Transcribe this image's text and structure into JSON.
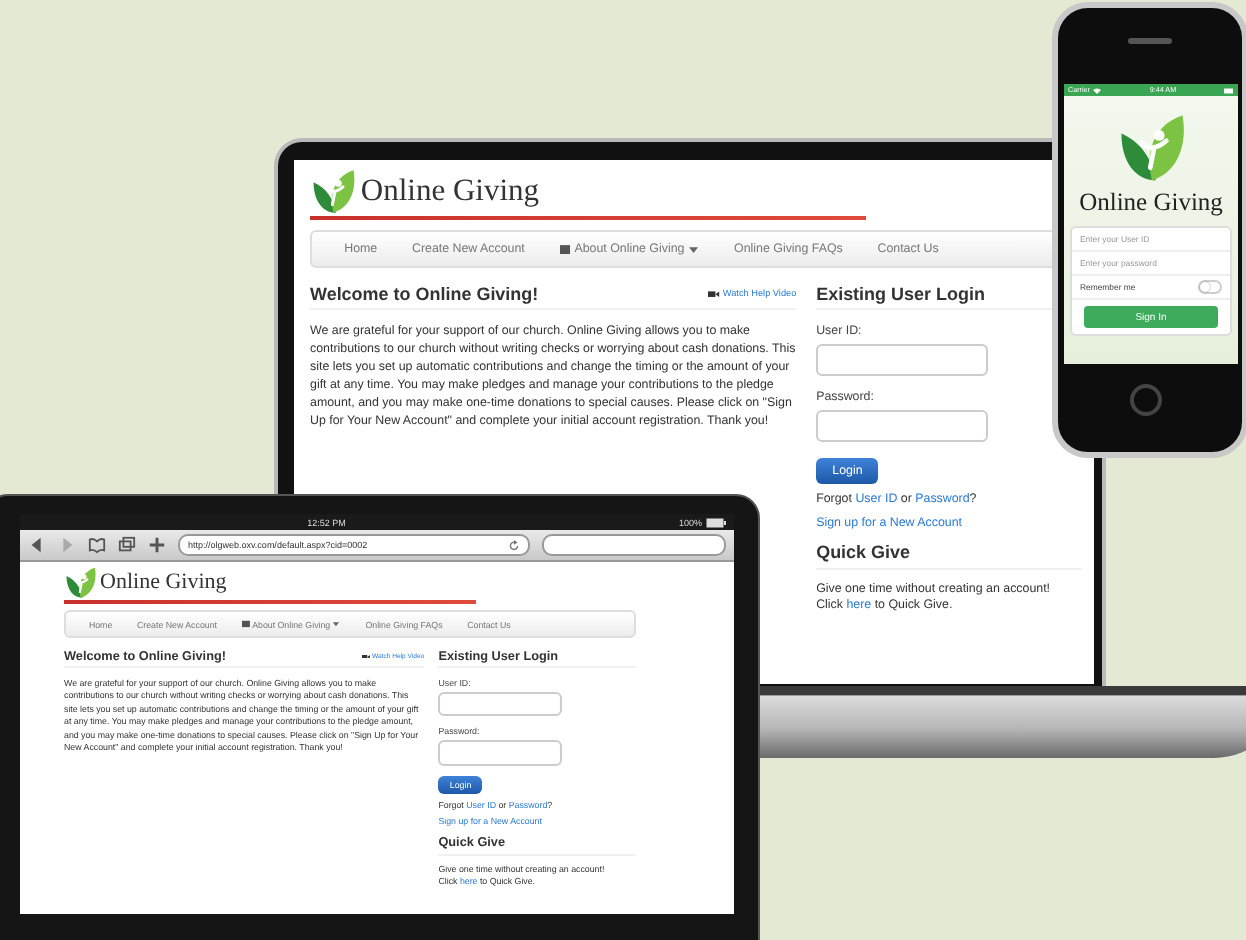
{
  "laptop": {
    "site": {
      "logo": "Online Giving",
      "nav": [
        {
          "label": "Home",
          "dropdown": false
        },
        {
          "label": "Create New Account",
          "dropdown": false
        },
        {
          "label": "About Online Giving",
          "dropdown": true
        },
        {
          "label": "Online Giving FAQs",
          "dropdown": false
        },
        {
          "label": "Contact Us",
          "dropdown": false
        }
      ],
      "welcome": {
        "title": "Welcome to Online Giving!",
        "help_link": "Watch Help Video",
        "body": "We are grateful for your support of our church. Online Giving allows you to make contributions to our church without writing checks or worrying about cash donations. This site lets you set up automatic contributions and change the timing or the amount of your gift at any time. You may make pledges and manage your contributions to the pledge amount, and you may make one-time donations to special causes. Please click on \"Sign Up for Your New Account\" and complete your initial account registration. Thank you!"
      },
      "login": {
        "title": "Existing User Login",
        "user_label": "User ID:",
        "password_label": "Password:",
        "button": "Login",
        "forgot": {
          "text_before": "Forgot",
          "user_id_link": "User ID",
          "text_between": "or",
          "password_link": "Password",
          "text_after": "?"
        },
        "signup_link": "Sign up for a New Account"
      },
      "quick_give": {
        "title": "Quick Give",
        "line_1": "Give one time without creating an account!",
        "text_before": "Click",
        "link": "here",
        "text_after": "to Quick Give."
      }
    }
  },
  "tablet": {
    "status_bar": {
      "time": "12:52 PM",
      "battery": "100%"
    },
    "address_bar": {
      "url": "http://olgweb.oxv.com/default.aspx?cid=0002"
    },
    "site": {
      "logo": "Online Giving",
      "nav": [
        {
          "label": "Home",
          "dropdown": false
        },
        {
          "label": "Create New Account",
          "dropdown": false
        },
        {
          "label": "About Online Giving",
          "dropdown": true
        },
        {
          "label": "Online Giving FAQs",
          "dropdown": false
        },
        {
          "label": "Contact Us",
          "dropdown": false
        }
      ],
      "welcome": {
        "title": "Welcome to Online Giving!",
        "help_link": "Watch Help Video",
        "body": "We are grateful for your support of our church. Online Giving allows you to make contributions to our church without writing checks or worrying about cash donations. This site lets you set up automatic contributions and change the timing or the amount of your gift at any time. You may make pledges and manage your contributions to the pledge amount, and you may make one-time donations to special causes. Please click on \"Sign Up for Your New Account\" and complete your initial account registration. Thank you!"
      },
      "login": {
        "title": "Existing User Login",
        "user_label": "User ID:",
        "password_label": "Password:",
        "button": "Login",
        "forgot": {
          "text_before": "Forgot",
          "user_id_link": "User ID",
          "text_between": "or",
          "password_link": "Password",
          "text_after": "?"
        },
        "signup_link": "Sign up for a New Account"
      },
      "quick_give": {
        "title": "Quick Give",
        "line_1": "Give one time without creating an account!",
        "text_before": "Click",
        "link": "here",
        "text_after": "to Quick Give."
      }
    }
  },
  "phone": {
    "status_bar": {
      "carrier": "Carrier",
      "time": "9:44 AM"
    },
    "logo": "Online Giving",
    "user_field": {
      "placeholder": "Enter your User ID"
    },
    "password_field": {
      "placeholder": "Enter your password"
    },
    "remember": {
      "label": "Remember me",
      "on": false
    },
    "sign_in": "Sign In"
  }
}
